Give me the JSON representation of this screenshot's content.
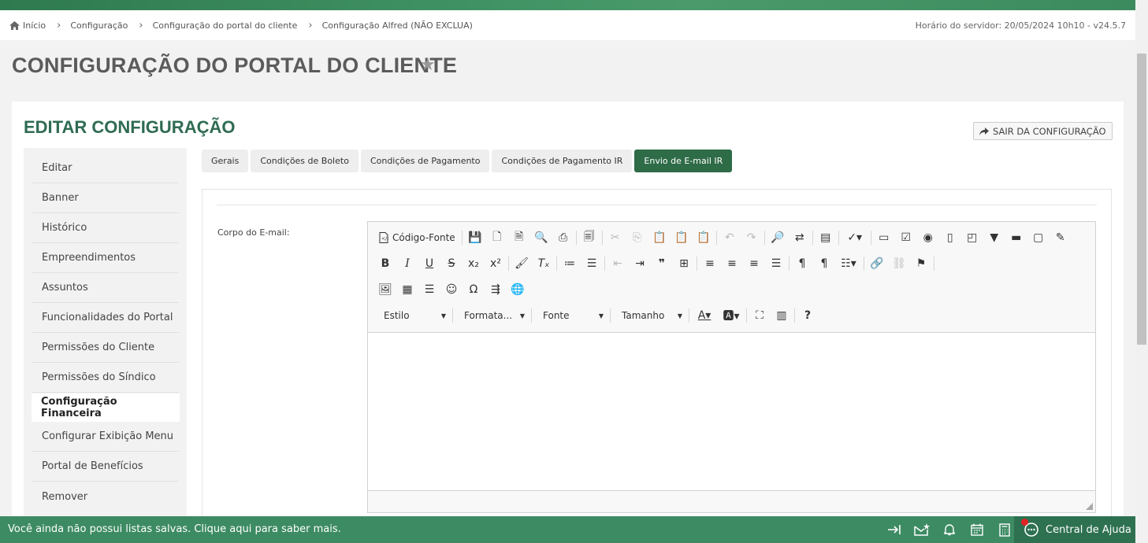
{
  "breadcrumb": {
    "items": [
      "Início",
      "Configuração",
      "Configuração do portal do cliente",
      "Configuração Alfred (NÃO EXCLUA)"
    ],
    "server_time": "Horário do servidor: 20/05/2024 10h10 - v24.5.7"
  },
  "page": {
    "title": "CONFIGURAÇÃO DO PORTAL DO CLIENTE",
    "card_title": "EDITAR CONFIGURAÇÃO",
    "exit_label": "SAIR DA CONFIGURAÇÃO"
  },
  "sidebar": {
    "items": [
      {
        "label": "Editar"
      },
      {
        "label": "Banner"
      },
      {
        "label": "Histórico"
      },
      {
        "label": "Empreendimentos"
      },
      {
        "label": "Assuntos"
      },
      {
        "label": "Funcionalidades do Portal"
      },
      {
        "label": "Permissões do Cliente"
      },
      {
        "label": "Permissões do Síndico"
      },
      {
        "label": "Configuração Financeira",
        "active": true
      },
      {
        "label": "Configurar Exibição Menu"
      },
      {
        "label": "Portal de Benefícios"
      },
      {
        "label": "Remover"
      }
    ]
  },
  "tabs": [
    {
      "label": "Gerais"
    },
    {
      "label": "Condições de Boleto"
    },
    {
      "label": "Condições de Pagamento"
    },
    {
      "label": "Condições de Pagamento IR"
    },
    {
      "label": "Envio de E-mail IR",
      "active": true
    }
  ],
  "form": {
    "field_label": "Corpo do E-mail:",
    "editor": {
      "source_label": "Código-Fonte",
      "combos": {
        "style": "Estilo",
        "format": "Formata...",
        "font": "Fonte",
        "size": "Tamanho"
      },
      "content": ""
    }
  },
  "bottombar": {
    "message": "Você ainda não possui listas salvas. Clique aqui para saber mais.",
    "help_label": "Central de Ajuda"
  },
  "colors": {
    "accent": "#2e6b47",
    "bar": "#3d8b63",
    "title": "#2f6b52"
  }
}
